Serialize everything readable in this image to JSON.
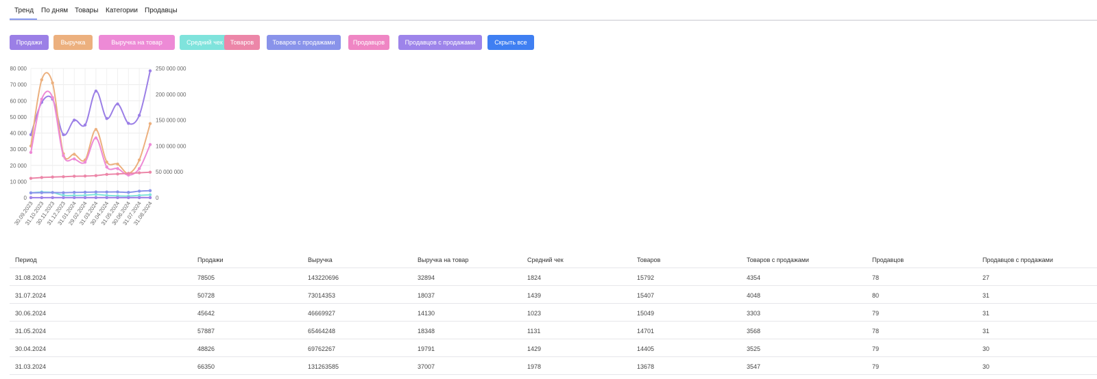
{
  "tabs": [
    {
      "label": "Тренд",
      "active": true
    },
    {
      "label": "По дням",
      "active": false
    },
    {
      "label": "Товары",
      "active": false
    },
    {
      "label": "Категории",
      "active": false
    },
    {
      "label": "Продавцы",
      "active": false
    }
  ],
  "toggles": [
    {
      "label": "Продажи",
      "color": "#9b7fe6"
    },
    {
      "label": "Выручка",
      "color": "#ecb07e"
    },
    {
      "label": "Выручка на товар",
      "color": "#ed8ad6"
    },
    {
      "label": "Средний чек",
      "color": "#7fe3dc"
    },
    {
      "label": "Товаров",
      "color": "#ec86a8"
    },
    {
      "label": "Товаров с продажами",
      "color": "#8993ea"
    },
    {
      "label": "Продавцов",
      "color": "#ef86c4"
    },
    {
      "label": "Продавцов с продажами",
      "color": "#9d84ea"
    },
    {
      "label": "Скрыть все",
      "color": "#3f7ff2"
    }
  ],
  "chart_data": {
    "type": "line",
    "x": [
      "30.09.2023",
      "31.10.2023",
      "30.11.2023",
      "31.12.2023",
      "31.01.2024",
      "29.02.2024",
      "31.03.2024",
      "30.04.2024",
      "31.05.2024",
      "30.06.2024",
      "31.07.2024",
      "31.08.2024"
    ],
    "y_left_ticks": [
      "80 000",
      "70 000",
      "60 000",
      "50 000",
      "40 000",
      "30 000",
      "20 000",
      "10 000",
      "0"
    ],
    "y_left_range": [
      0,
      80000
    ],
    "y_right_ticks": [
      "250 000 000",
      "200 000 000",
      "150 000 000",
      "100 000 000",
      "50 000 000",
      "0"
    ],
    "y_right_range": [
      0,
      250000000
    ],
    "grid": true,
    "series": [
      {
        "axis": "left",
        "color": "#9b7fe6",
        "values": [
          39000,
          59000,
          61000,
          39000,
          48000,
          45000,
          66000,
          49000,
          58000,
          46000,
          51000,
          78505
        ]
      },
      {
        "axis": "right",
        "color": "#ecb07e",
        "values": [
          100000000,
          228000000,
          222000000,
          85000000,
          84000000,
          73000000,
          132000000,
          69000000,
          65000000,
          47000000,
          73000000,
          143220696
        ]
      },
      {
        "axis": "left",
        "color": "#ed8ad6",
        "values": [
          28000,
          61000,
          62000,
          26000,
          24000,
          22000,
          37000,
          19000,
          18000,
          14000,
          18000,
          32894
        ]
      },
      {
        "axis": "left",
        "color": "#7fe3dc",
        "values": [
          3000,
          3500,
          3200,
          1500,
          1400,
          1500,
          1978,
          1429,
          1131,
          1023,
          1439,
          1824
        ]
      },
      {
        "axis": "left",
        "color": "#ec86a8",
        "values": [
          12000,
          12500,
          12800,
          13000,
          13300,
          13400,
          13678,
          14405,
          14701,
          15049,
          15407,
          15792
        ]
      },
      {
        "axis": "left",
        "color": "#8993ea",
        "values": [
          3000,
          3100,
          3200,
          3100,
          3300,
          3400,
          3547,
          3525,
          3568,
          3303,
          4048,
          4354
        ]
      },
      {
        "axis": "left",
        "color": "#ef86c4",
        "values": [
          70,
          72,
          74,
          75,
          76,
          78,
          79,
          79,
          78,
          79,
          80,
          78
        ]
      },
      {
        "axis": "left",
        "color": "#9d84ea",
        "values": [
          25,
          26,
          27,
          28,
          28,
          29,
          30,
          30,
          31,
          31,
          31,
          27
        ]
      }
    ]
  },
  "table": {
    "headers": [
      "Период",
      "Продажи",
      "Выручка",
      "Выручка на товар",
      "Средний чек",
      "Товаров",
      "Товаров с продажами",
      "Продавцов",
      "Продавцов с продажами"
    ],
    "rows": [
      [
        "31.08.2024",
        "78505",
        "143220696",
        "32894",
        "1824",
        "15792",
        "4354",
        "78",
        "27"
      ],
      [
        "31.07.2024",
        "50728",
        "73014353",
        "18037",
        "1439",
        "15407",
        "4048",
        "80",
        "31"
      ],
      [
        "30.06.2024",
        "45642",
        "46669927",
        "14130",
        "1023",
        "15049",
        "3303",
        "79",
        "31"
      ],
      [
        "31.05.2024",
        "57887",
        "65464248",
        "18348",
        "1131",
        "14701",
        "3568",
        "78",
        "31"
      ],
      [
        "30.04.2024",
        "48826",
        "69762267",
        "19791",
        "1429",
        "14405",
        "3525",
        "79",
        "30"
      ],
      [
        "31.03.2024",
        "66350",
        "131263585",
        "37007",
        "1978",
        "13678",
        "3547",
        "79",
        "30"
      ]
    ]
  }
}
